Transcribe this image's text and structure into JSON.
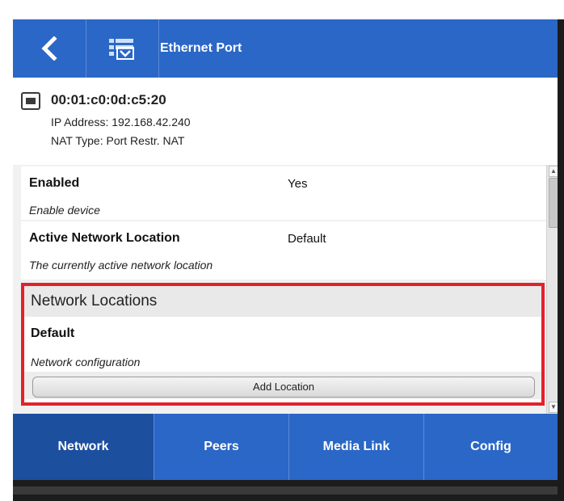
{
  "header": {
    "title": "Ethernet Port",
    "back_icon": "chevron-left-icon",
    "nav_icon": "network-list-icon"
  },
  "device": {
    "mac": "00:01:c0:0d:c5:20",
    "ip": "IP Address: 192.168.42.240",
    "nat": "NAT Type: Port Restr. NAT",
    "icon": "ethernet-port-icon"
  },
  "rows": [
    {
      "title": "Enabled",
      "value": "Yes",
      "description": "Enable device"
    },
    {
      "title": "Active Network Location",
      "value": "Default",
      "description": "The currently active network location"
    }
  ],
  "network_locations": {
    "header": "Network Locations",
    "item_title": "Default",
    "item_description": "Network configuration",
    "add_button": "Add Location"
  },
  "tabs": [
    {
      "label": "Network",
      "active": true
    },
    {
      "label": "Peers",
      "active": false
    },
    {
      "label": "Media Link",
      "active": false
    },
    {
      "label": "Config",
      "active": false
    }
  ],
  "colors": {
    "header_blue": "#2a67c7",
    "active_tab_blue": "#1d4f9f",
    "highlight_red": "#e2222b"
  }
}
